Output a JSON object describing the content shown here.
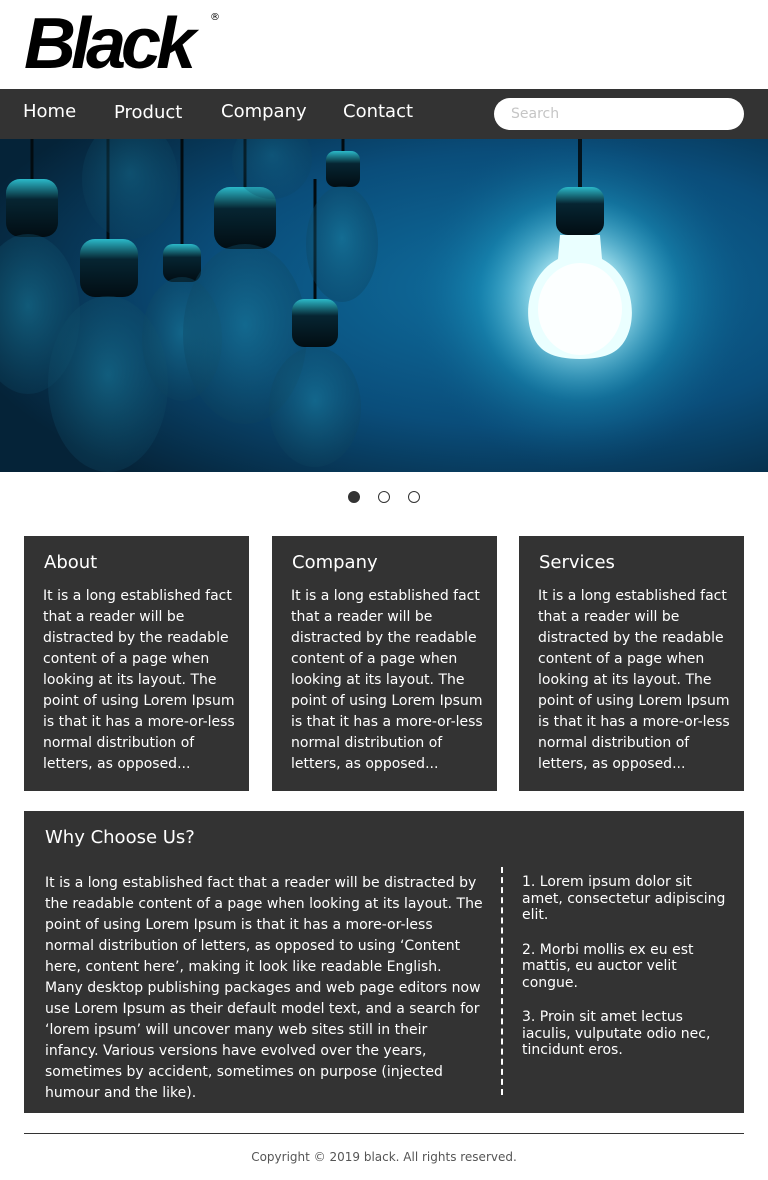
{
  "brand": {
    "logo_text": "Black",
    "logo_mark": "®"
  },
  "nav": {
    "items": [
      {
        "label": "Home"
      },
      {
        "label": "Product"
      },
      {
        "label": "Company"
      },
      {
        "label": "Contact"
      }
    ],
    "search_placeholder": "Search"
  },
  "hero": {
    "image": "light-bulbs-photo",
    "slides_total": 3,
    "active_slide": 1
  },
  "cards": [
    {
      "title": "About",
      "body": "It is a long established fact that a reader will be distracted by the readable content of a page when looking at its layout. The point of using Lorem Ipsum is that it has a more-or-less normal distribution of letters, as opposed..."
    },
    {
      "title": "Company",
      "body": "It is a long established fact that a reader will be distracted by the readable content of a page when looking at its layout. The point of using Lorem Ipsum is that it has a more-or-less normal distribution of letters, as opposed..."
    },
    {
      "title": "Services",
      "body": "It is a long established fact that a reader will be distracted by the readable content of a page when looking at its layout. The point of using Lorem Ipsum is that it has a more-or-less normal distribution of letters, as opposed..."
    }
  ],
  "why": {
    "title": "Why Choose Us?",
    "body": "It is a long established fact that a reader will be distracted by the readable content of a page when looking at its layout. The point of using Lorem Ipsum is that it has a more-or-less normal distribution of letters, as opposed to using ‘Content here, content here’, making it look like readable English. Many desktop publishing packages and web page editors now use Lorem Ipsum as their default model text, and a search for ‘lorem ipsum’ will uncover many web sites still in their infancy. Various versions have evolved over the years, sometimes by accident, sometimes on purpose (injected humour and the like).",
    "list": [
      "1. Lorem ipsum dolor sit amet, consectetur adipiscing elit.",
      "2. Morbi mollis ex eu est mattis, eu auctor velit congue.",
      "3. Proin sit amet lectus iaculis, vulputate odio nec, tincidunt eros."
    ]
  },
  "footer": {
    "copyright": "Copyright © 2019 black. All rights reserved."
  },
  "colors": {
    "dark": "#333333",
    "white": "#ffffff",
    "hero_blue": "#0a4f78",
    "bulb_glow": "#e9ffff"
  }
}
